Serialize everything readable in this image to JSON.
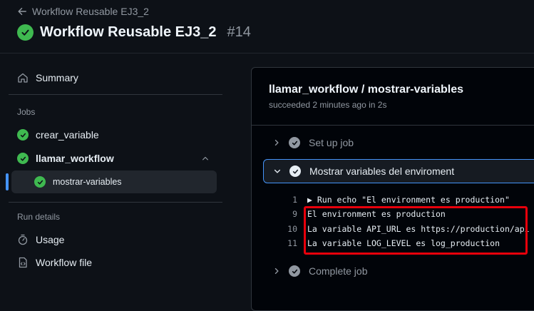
{
  "header": {
    "back_label": "Workflow Reusable EJ3_2",
    "title": "Workflow Reusable EJ3_2",
    "run_number": "#14"
  },
  "sidebar": {
    "summary_label": "Summary",
    "jobs_heading": "Jobs",
    "jobs": [
      {
        "label": "crear_variable"
      },
      {
        "label": "llamar_workflow"
      }
    ],
    "subjob_label": "mostrar-variables",
    "run_details_heading": "Run details",
    "usage_label": "Usage",
    "workflow_file_label": "Workflow file"
  },
  "main": {
    "job_title": "llamar_workflow / mostrar-variables",
    "job_status": "succeeded 2 minutes ago in 2s",
    "steps": {
      "setup": "Set up job",
      "show_vars": "Mostrar variables del enviroment",
      "complete": "Complete job"
    },
    "log": [
      {
        "num": "1",
        "text": "▶ Run echo \"El environment es production\""
      },
      {
        "num": "9",
        "text": "El environment es production"
      },
      {
        "num": "10",
        "text": "La variable API_URL es https://production/api"
      },
      {
        "num": "11",
        "text": "La variable LOG_LEVEL es log_production"
      }
    ]
  },
  "colors": {
    "success": "#3fb950",
    "accent": "#4493f8",
    "highlight": "#e8000b"
  }
}
